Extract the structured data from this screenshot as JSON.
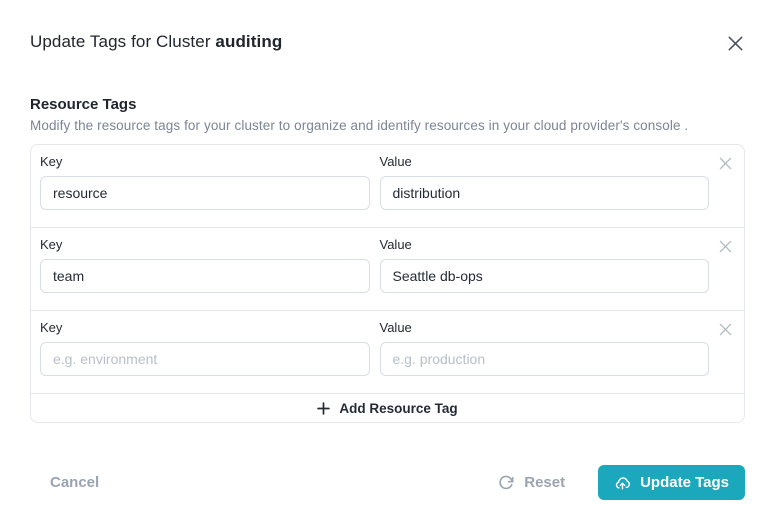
{
  "modal": {
    "title_prefix": "Update Tags for Cluster",
    "cluster_name": "auditing"
  },
  "section": {
    "heading": "Resource Tags",
    "description": "Modify the resource tags for your cluster to organize and identify resources in your cloud provider's console ."
  },
  "labels": {
    "key": "Key",
    "value": "Value"
  },
  "tag_rows": [
    {
      "key": "resource",
      "value": "distribution"
    },
    {
      "key": "team",
      "value": "Seattle db-ops"
    },
    {
      "key": "",
      "value": "",
      "key_placeholder": "e.g. environment",
      "value_placeholder": "e.g. production"
    }
  ],
  "add_button": {
    "label": "Add Resource Tag"
  },
  "footer": {
    "cancel": "Cancel",
    "reset": "Reset",
    "update": "Update Tags"
  },
  "icons": {
    "close": "close-icon",
    "remove_row": "close-icon",
    "reset": "refresh-icon",
    "update": "upload-cloud-icon",
    "add": "plus-icon"
  },
  "colors": {
    "accent_teal": "#1ba8bc",
    "muted_text": "#9aa4b2",
    "card_border": "#e4e7ec",
    "input_border": "#d8dde6"
  }
}
